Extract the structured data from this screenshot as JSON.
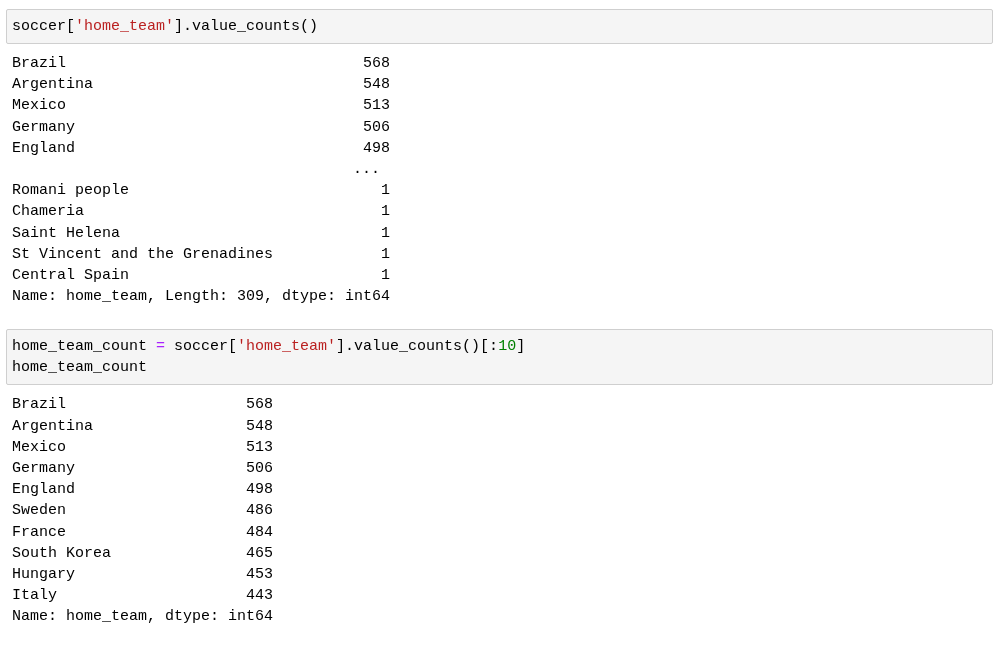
{
  "cells": [
    {
      "input": [
        [
          {
            "kind": "plain",
            "text": "soccer["
          },
          {
            "kind": "string",
            "text": "'home_team'"
          },
          {
            "kind": "plain",
            "text": "].value_counts()"
          }
        ]
      ],
      "output": {
        "rows": [
          {
            "kind": "entry",
            "label": "Brazil",
            "value": "568"
          },
          {
            "kind": "entry",
            "label": "Argentina",
            "value": "548"
          },
          {
            "kind": "entry",
            "label": "Mexico",
            "value": "513"
          },
          {
            "kind": "entry",
            "label": "Germany",
            "value": "506"
          },
          {
            "kind": "entry",
            "label": "England",
            "value": "498"
          },
          {
            "kind": "ellipsis",
            "value": "..."
          },
          {
            "kind": "entry",
            "label": "Romani people",
            "value": "1"
          },
          {
            "kind": "entry",
            "label": "Chameria",
            "value": "1"
          },
          {
            "kind": "entry",
            "label": "Saint Helena",
            "value": "1"
          },
          {
            "kind": "entry",
            "label": "St Vincent and the Grenadines",
            "value": "1"
          },
          {
            "kind": "entry",
            "label": "Central Spain",
            "value": "1"
          }
        ],
        "footer": "Name: home_team, Length: 309, dtype: int64"
      }
    },
    {
      "input": [
        [
          {
            "kind": "plain",
            "text": "home_team_count "
          },
          {
            "kind": "operator",
            "text": "="
          },
          {
            "kind": "plain",
            "text": " soccer["
          },
          {
            "kind": "string",
            "text": "'home_team'"
          },
          {
            "kind": "plain",
            "text": "].value_counts()[:"
          },
          {
            "kind": "number",
            "text": "10"
          },
          {
            "kind": "plain",
            "text": "]"
          }
        ],
        [
          {
            "kind": "plain",
            "text": "home_team_count"
          }
        ]
      ],
      "output": {
        "rows": [
          {
            "kind": "entry",
            "label": "Brazil",
            "value": "568"
          },
          {
            "kind": "entry",
            "label": "Argentina",
            "value": "548"
          },
          {
            "kind": "entry",
            "label": "Mexico",
            "value": "513"
          },
          {
            "kind": "entry",
            "label": "Germany",
            "value": "506"
          },
          {
            "kind": "entry",
            "label": "England",
            "value": "498"
          },
          {
            "kind": "entry",
            "label": "Sweden",
            "value": "486"
          },
          {
            "kind": "entry",
            "label": "France",
            "value": "484"
          },
          {
            "kind": "entry",
            "label": "South Korea",
            "value": "465"
          },
          {
            "kind": "entry",
            "label": "Hungary",
            "value": "453"
          },
          {
            "kind": "entry",
            "label": "Italy",
            "value": "443"
          }
        ],
        "footer": "Name: home_team, dtype: int64"
      }
    }
  ]
}
